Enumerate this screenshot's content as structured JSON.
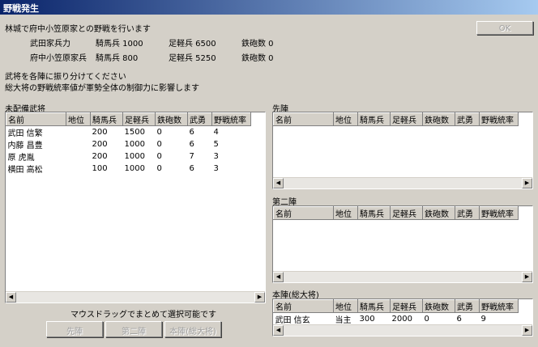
{
  "window": {
    "title": "野戦発生"
  },
  "intro": {
    "line": "林城で府中小笠原家との野戦を行います"
  },
  "forces": [
    {
      "name": "武田家兵力",
      "cavalry": "騎馬兵 1000",
      "infantry": "足軽兵 6500",
      "guns": "鉄砲数 0"
    },
    {
      "name": "府中小笠原家兵",
      "cavalry": "騎馬兵 800",
      "infantry": "足軽兵 5250",
      "guns": "鉄砲数 0"
    }
  ],
  "instructions": {
    "line1": "武将を各陣に振り分けてください",
    "line2": "総大将の野戦統率値が軍勢全体の制御力に影響します"
  },
  "ok_button": "OK",
  "columns": [
    "名前",
    "地位",
    "騎馬兵",
    "足軽兵",
    "鉄砲数",
    "武勇",
    "野戦統率"
  ],
  "unassigned": {
    "label": "未配備武将",
    "rows": [
      [
        "武田 信繁",
        "",
        "200",
        "1500",
        "0",
        "6",
        "4"
      ],
      [
        "内藤 昌豊",
        "",
        "200",
        "1000",
        "0",
        "6",
        "5"
      ],
      [
        "原 虎胤",
        "",
        "200",
        "1000",
        "0",
        "7",
        "3"
      ],
      [
        "横田 高松",
        "",
        "100",
        "1000",
        "0",
        "6",
        "3"
      ]
    ]
  },
  "vanguard": {
    "label": "先陣",
    "rows": []
  },
  "second": {
    "label": "第二陣",
    "rows": []
  },
  "main": {
    "label": "本陣(総大将)",
    "rows": [
      [
        "武田 信玄",
        "当主",
        "300",
        "2000",
        "0",
        "6",
        "9"
      ]
    ]
  },
  "drag_hint": "マウスドラッグでまとめて選択可能です",
  "assign_buttons": {
    "vanguard": "先陣",
    "second": "第二陣",
    "main": "本陣(総大将)"
  },
  "scroll_icons": {
    "left": "◀",
    "right": "▶"
  }
}
